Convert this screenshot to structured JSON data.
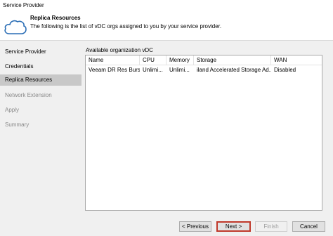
{
  "window": {
    "title": "Service Provider"
  },
  "header": {
    "title": "Replica Resources",
    "subtitle": "The following is the list of vDC orgs assigned to you by your service provider."
  },
  "sidebar": {
    "items": [
      {
        "label": "Service Provider",
        "state": "normal"
      },
      {
        "label": "Credentials",
        "state": "normal"
      },
      {
        "label": "Replica Resources",
        "state": "active"
      },
      {
        "label": "Network Extension",
        "state": "disabled"
      },
      {
        "label": "Apply",
        "state": "disabled"
      },
      {
        "label": "Summary",
        "state": "disabled"
      }
    ]
  },
  "main": {
    "section_label": "Available organization vDC",
    "columns": [
      "Name",
      "CPU",
      "Memory",
      "Storage",
      "WAN"
    ],
    "rows": [
      [
        "Veeam DR Res Burs...",
        "Unlimi...",
        "Unlimi...",
        "iland Accelerated Storage Ad...",
        "Disabled"
      ]
    ]
  },
  "footer": {
    "previous_label": "< Previous",
    "next_label": "Next >",
    "finish_label": "Finish",
    "cancel_label": "Cancel"
  },
  "colors": {
    "active_nav": "#c8c8c8",
    "sidebar_bg": "#f0f0f0",
    "next_highlight": "#c0392b",
    "cloud_icon": "#2a6db5"
  }
}
